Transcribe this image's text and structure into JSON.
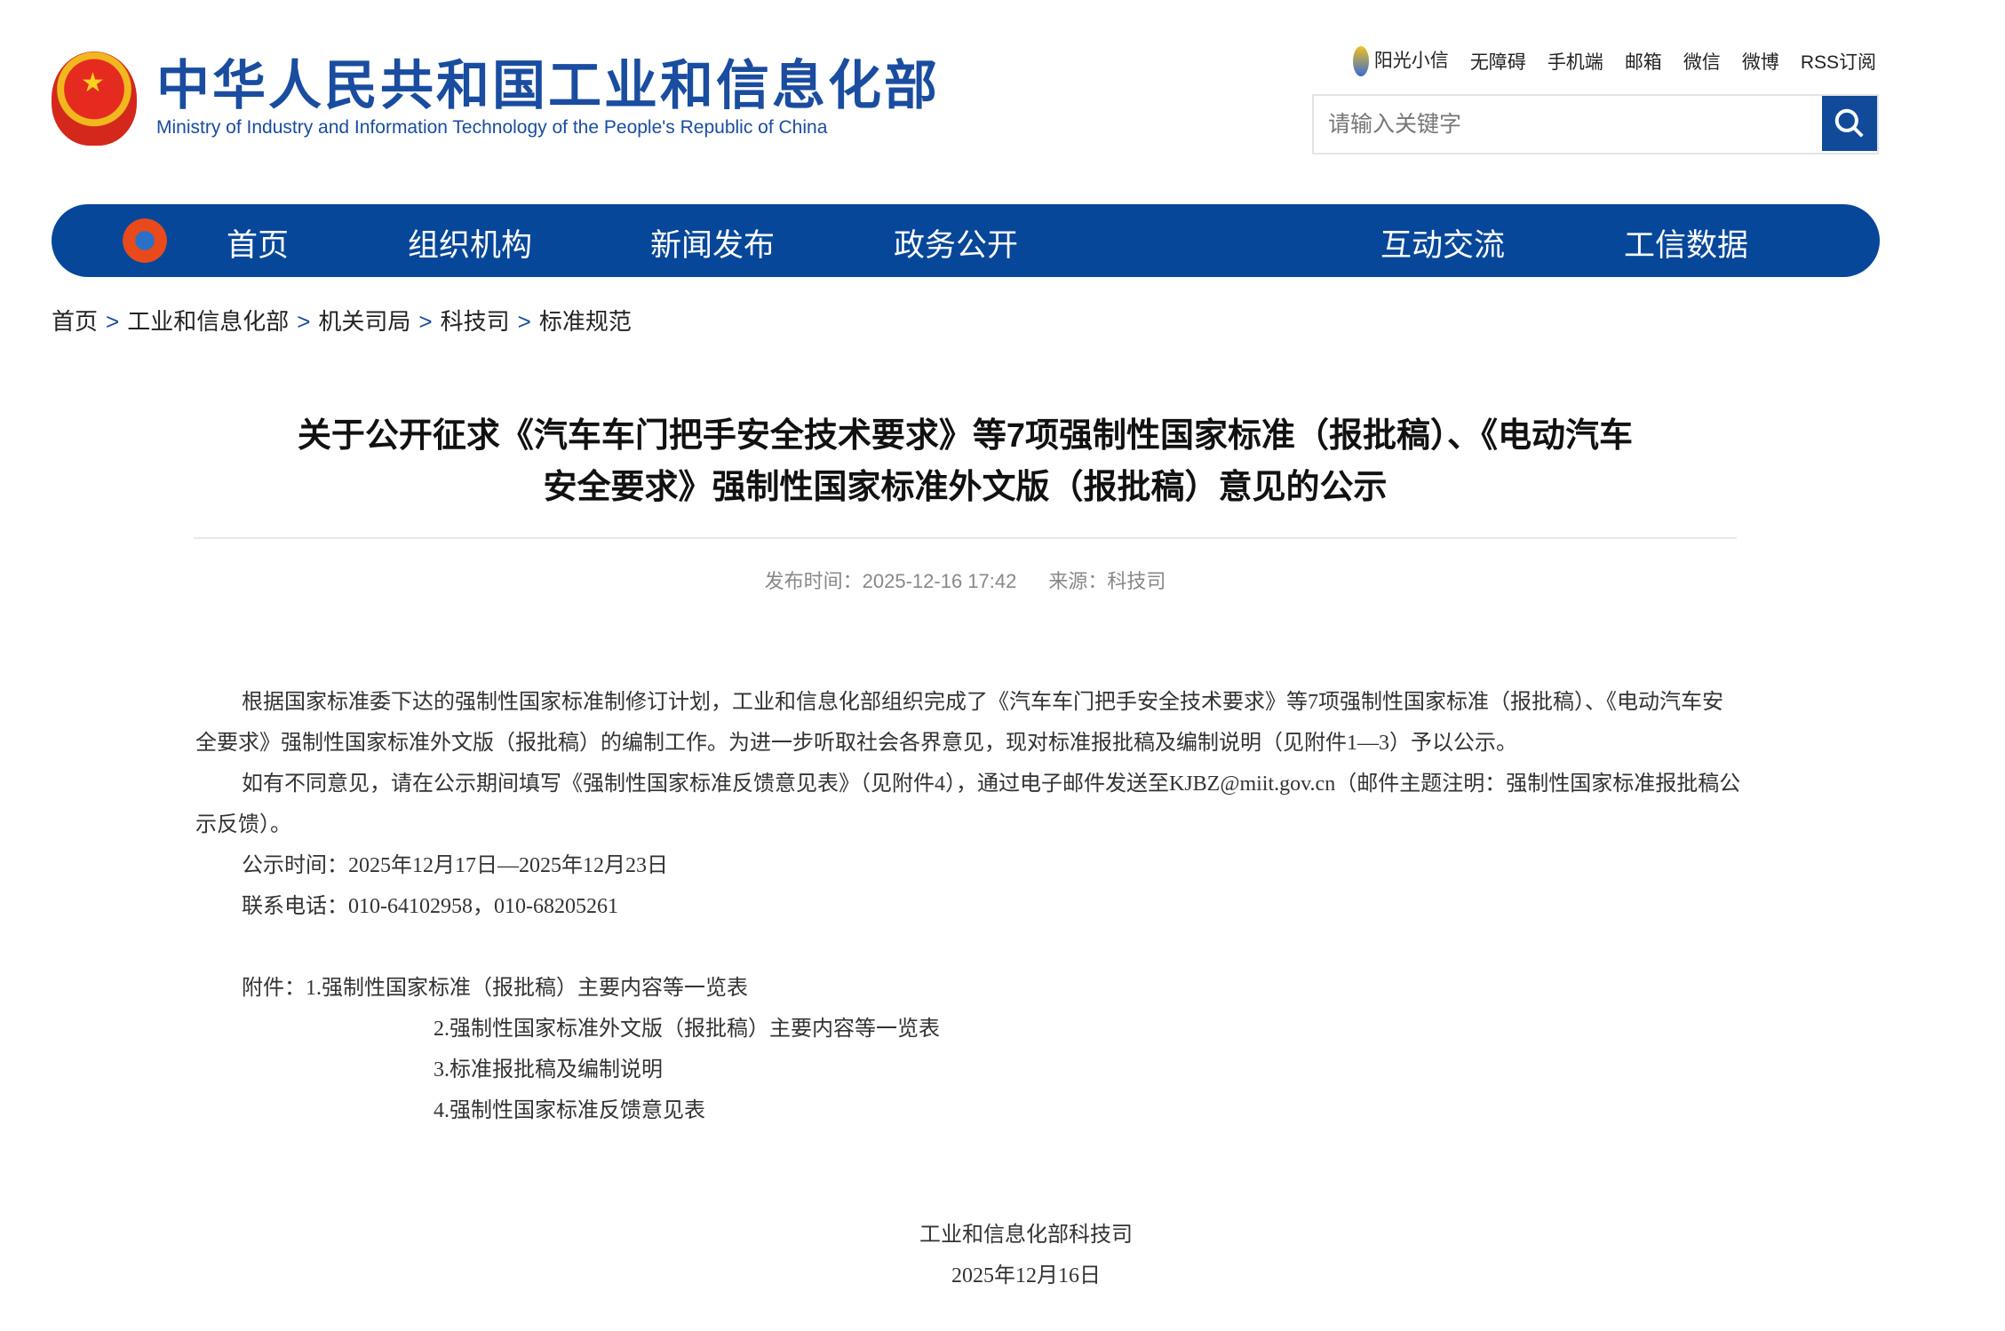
{
  "header": {
    "title_cn": "中华人民共和国工业和信息化部",
    "title_en": "Ministry of Industry and Information Technology of the People's Republic of China",
    "top_links": [
      "阳光小信",
      "无障碍",
      "手机端",
      "邮箱",
      "微信",
      "微博",
      "RSS订阅"
    ],
    "search_placeholder": "请输入关键字"
  },
  "nav": [
    "首页",
    "组织机构",
    "新闻发布",
    "政务公开",
    "互动交流",
    "工信数据"
  ],
  "breadcrumb": [
    "首页",
    "工业和信息化部",
    "机关司局",
    "科技司",
    "标准规范"
  ],
  "breadcrumb_sep": ">",
  "article": {
    "title_line1": "关于公开征求《汽车车门把手安全技术要求》等7项强制性国家标准（报批稿）、《电动汽车",
    "title_line2": "安全要求》强制性国家标准外文版（报批稿）意见的公示",
    "publish_time": "发布时间：2025-12-16 17:42",
    "source": "来源：科技司",
    "paragraphs": [
      "根据国家标准委下达的强制性国家标准制修订计划，工业和信息化部组织完成了《汽车车门把手安全技术要求》等7项强制性国家标准（报批稿）、《电动汽车安全要求》强制性国家标准外文版（报批稿）的编制工作。为进一步听取社会各界意见，现对标准报批稿及编制说明（见附件1—3）予以公示。",
      "如有不同意见，请在公示期间填写《强制性国家标准反馈意见表》（见附件4），通过电子邮件发送至KJBZ@miit.gov.cn（邮件主题注明：强制性国家标准报批稿公示反馈）。",
      "公示时间：2025年12月17日—2025年12月23日",
      "联系电话：010-64102958，010-68205261"
    ],
    "attachments_label": "附件：",
    "attachments": [
      "1.强制性国家标准（报批稿）主要内容等一览表",
      "2.强制性国家标准外文版（报批稿）主要内容等一览表",
      "3.标准报批稿及编制说明",
      "4.强制性国家标准反馈意见表"
    ],
    "signature": "工业和信息化部科技司",
    "date": "2025年12月16日"
  },
  "colors": {
    "brand": "#07479a"
  }
}
